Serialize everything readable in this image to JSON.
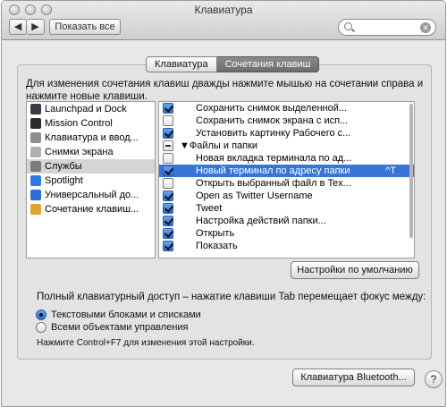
{
  "window": {
    "title": "Клавиатура",
    "show_all_label": "Показать все",
    "back_glyph": "◀",
    "forward_glyph": "▶",
    "search_value": "",
    "clear_glyph": "✕"
  },
  "tabs": [
    "Клавиатура",
    "Сочетания клавиш"
  ],
  "instructions": "Для изменения сочетания клавиш дважды нажмите мышью на сочетании справа и нажмите новые клавиши.",
  "categories": [
    {
      "label": "Launchpad и Dock",
      "icon": "launchpad-icon",
      "color": "#3a3a46"
    },
    {
      "label": "Mission Control",
      "icon": "mission-control-icon",
      "color": "#2b2b2b"
    },
    {
      "label": "Клавиатура и ввод...",
      "icon": "keyboard-icon",
      "color": "#8f8f8f"
    },
    {
      "label": "Снимки экрана",
      "icon": "screenshot-icon",
      "color": "#b0b0b0"
    },
    {
      "label": "Службы",
      "icon": "services-gear-icon",
      "color": "#7b7b7b"
    },
    {
      "label": "Spotlight",
      "icon": "spotlight-icon",
      "color": "#2f7ae5"
    },
    {
      "label": "Универсальный до...",
      "icon": "accessibility-icon",
      "color": "#2b6fd6"
    },
    {
      "label": "Сочетание клавиш...",
      "icon": "app-shortcuts-icon",
      "color": "#e0a32e"
    }
  ],
  "selected_category": 4,
  "shortcuts": [
    {
      "label": "Сохранить снимок выделенной...",
      "checkbox": "on",
      "group": false,
      "key": ""
    },
    {
      "label": "Сохранить снимок экрана с исп...",
      "checkbox": "off",
      "group": false,
      "key": ""
    },
    {
      "label": "Установить картинку Рабочего с...",
      "checkbox": "on",
      "group": false,
      "key": ""
    },
    {
      "label": "▼Файлы и папки",
      "checkbox": "mixed",
      "group": true,
      "key": ""
    },
    {
      "label": "Новая вкладка терминала по ад...",
      "checkbox": "off",
      "group": false,
      "key": ""
    },
    {
      "label": "Новый терминал по адресу папки",
      "checkbox": "on",
      "group": false,
      "key": "^T"
    },
    {
      "label": "Открыть выбранный файл в Tex...",
      "checkbox": "off",
      "group": false,
      "key": ""
    },
    {
      "label": "Open as Twitter Username",
      "checkbox": "on",
      "group": false,
      "key": ""
    },
    {
      "label": "Tweet",
      "checkbox": "on",
      "group": false,
      "key": ""
    },
    {
      "label": "Настройка действий папки...",
      "checkbox": "on",
      "group": false,
      "key": ""
    },
    {
      "label": "Открыть",
      "checkbox": "on",
      "group": false,
      "key": ""
    },
    {
      "label": "Показать",
      "checkbox": "on",
      "group": false,
      "key": ""
    }
  ],
  "selected_shortcut": 5,
  "defaults_button": "Настройки по умолчанию",
  "full_access": {
    "label": "Полный клавиатурный доступ – нажатие клавиши Tab перемещает фокус между:",
    "options": [
      "Текстовыми блоками и списками",
      "Всеми объектами управления"
    ],
    "selected": 0,
    "hint": "Нажмите Control+F7 для изменения этой настройки."
  },
  "bluetooth_button": "Клавиатура Bluetooth...",
  "help_glyph": "?"
}
